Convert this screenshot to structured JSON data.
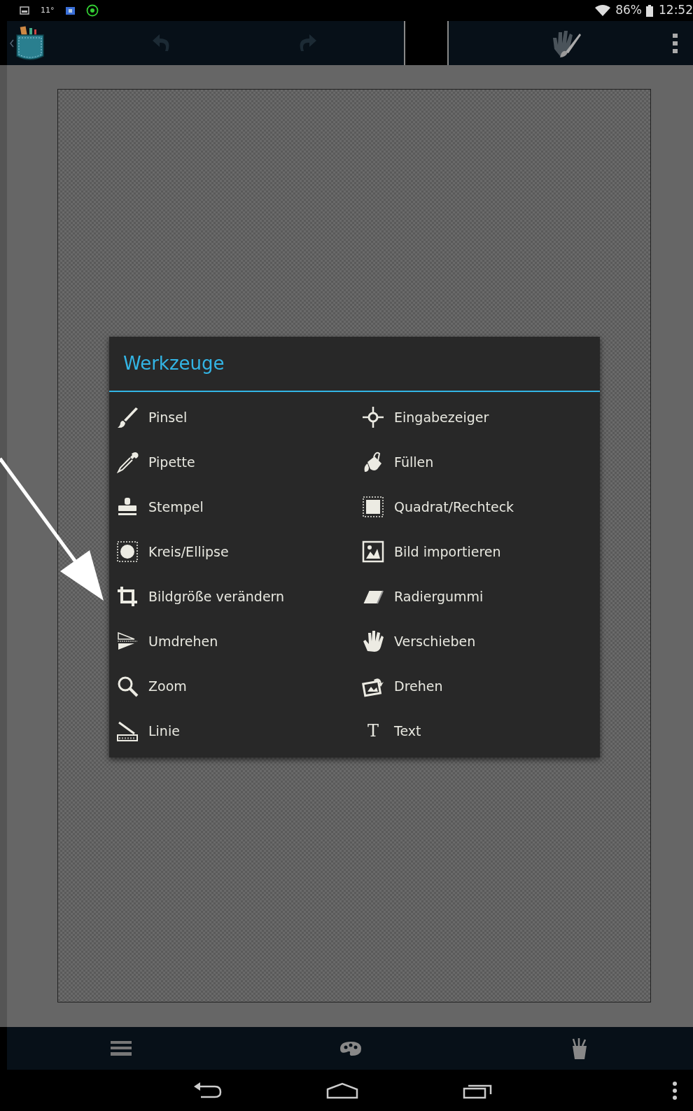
{
  "status_bar": {
    "temperature": "11°",
    "battery": "86%",
    "time": "12:52"
  },
  "dialog": {
    "title": "Werkzeuge",
    "items": [
      {
        "label": "Pinsel",
        "selected": false
      },
      {
        "label": "Eingabezeiger",
        "selected": false
      },
      {
        "label": "Pipette",
        "selected": false
      },
      {
        "label": "Füllen",
        "selected": false
      },
      {
        "label": "Stempel",
        "selected": false
      },
      {
        "label": "Quadrat/Rechteck",
        "selected": false
      },
      {
        "label": "Kreis/Ellipse",
        "selected": false
      },
      {
        "label": "Bild importieren",
        "selected": false
      },
      {
        "label": "Bildgröße verändern",
        "selected": false
      },
      {
        "label": "Radiergummi",
        "selected": false
      },
      {
        "label": "Umdrehen",
        "selected": false
      },
      {
        "label": "Verschieben",
        "selected": false
      },
      {
        "label": "Zoom",
        "selected": false
      },
      {
        "label": "Drehen",
        "selected": false
      },
      {
        "label": "Linie",
        "selected": false
      },
      {
        "label": "Text",
        "selected": false,
        "icon_glyph": "T"
      }
    ]
  }
}
